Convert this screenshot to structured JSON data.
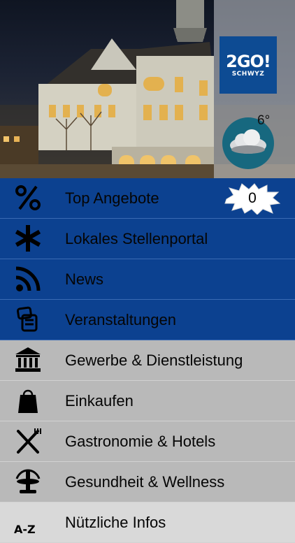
{
  "brand": {
    "title": "2GO!",
    "subtitle": "SCHWYZ",
    "color": "#0d4b93"
  },
  "weather": {
    "temperature": "6°",
    "icon": "cloud-icon"
  },
  "menu": {
    "items": [
      {
        "label": "Top Angebote",
        "icon": "percent-icon",
        "badge": "0"
      },
      {
        "label": "Lokales Stellenportal",
        "icon": "asterisk-icon"
      },
      {
        "label": "News",
        "icon": "rss-icon"
      },
      {
        "label": "Veranstaltungen",
        "icon": "ticket-icon"
      },
      {
        "label": "Gewerbe & Dienstleistung",
        "icon": "bank-icon"
      },
      {
        "label": "Einkaufen",
        "icon": "shopping-bag-icon"
      },
      {
        "label": "Gastronomie & Hotels",
        "icon": "fork-knife-icon"
      },
      {
        "label": "Gesundheit & Wellness",
        "icon": "fountain-icon"
      },
      {
        "label": "Nützliche Infos",
        "icon": "az-icon"
      }
    ]
  },
  "colors": {
    "primary": "#0c4190",
    "secondary": "#b9b9b9"
  }
}
